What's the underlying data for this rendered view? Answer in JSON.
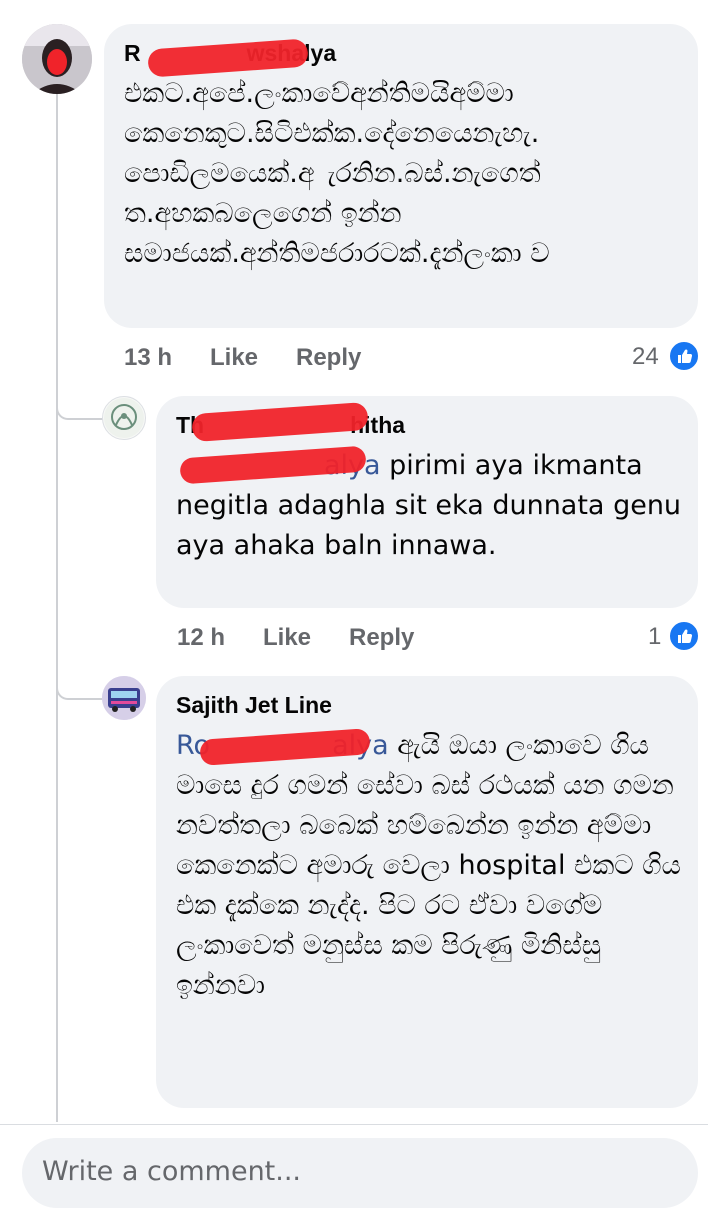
{
  "comments": [
    {
      "author": "Rochini Kaushalya",
      "author_visible_start": "R",
      "author_visible_end": "wshalya",
      "text": "එකට.අපේ.ලංකාවේඅන්තිමයිඅම්මා කෙනෙකුට.සිටිඑක්ක.දේනෙයෙනැහැ. පොඩිලමයෙක්.අ ැරනින.බස්.නැගෙත් ත.අහකබලෙගෙන් ඉන්න සමාජයක්.අන්තිමජරාරටක්.දැන්ලංකා ව",
      "time": "13 h",
      "like_label": "Like",
      "reply_label": "Reply",
      "reactions": "24"
    },
    {
      "author": "Thameera Shitha",
      "author_visible_start": "Th",
      "author_visible_end": "hitha",
      "mention": "Rochini Kaushalya",
      "mention_visible_end": "alya",
      "text": " pirimi aya ikmanta negitla adaghla  sit eka dunnata genu aya ahaka baln innawa.",
      "time": "12 h",
      "like_label": "Like",
      "reply_label": "Reply",
      "reactions": "1"
    },
    {
      "author": "Sajith Jet Line",
      "mention": "Rochini Kaushalya",
      "mention_visible_start": "Ro",
      "mention_visible_end": "alya",
      "text": " ඇයි ඔයා ලංකාවෙ ගිය මාසෙ දුර ගමන් සේවා බස් රථයක් යන ගමන නවත්තලා බබෙක් හම්බෙන්න ඉන්න අම්මා කෙනෙක්ට අමාරු වෙලා hospital එකට ගිය එක දැක්කෙ නැද්ද. පිට රට ඒවා වගේම ලංකාවෙත් මනුස්ස කම පිරුණු මිනිස්සු ඉන්නවා"
    }
  ],
  "composer": {
    "placeholder": "Write a comment..."
  },
  "colors": {
    "accent": "#1877f2",
    "mention": "#385898",
    "bubble": "#f0f2f5",
    "muted": "#65676b",
    "redaction": "#f0232a"
  },
  "icons": {
    "reaction": "like-thumb-icon"
  }
}
